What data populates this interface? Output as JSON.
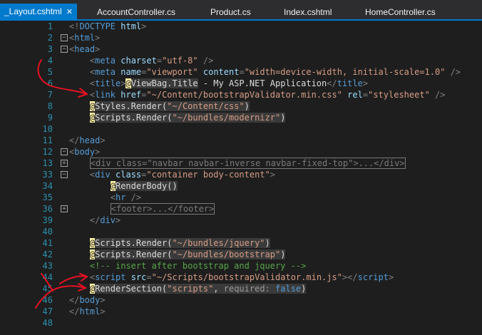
{
  "tabs": [
    {
      "label": "_Layout.cshtml",
      "close": "✕",
      "active": true
    },
    {
      "label": "AccountController.cs"
    },
    {
      "label": "Product.cs"
    },
    {
      "label": "Index.cshtml"
    },
    {
      "label": "HomeController.cs"
    }
  ],
  "lines": [
    {
      "num": "1",
      "fold": "",
      "indent": 0,
      "tokens": [
        {
          "c": "punct",
          "t": "<!"
        },
        {
          "c": "tag",
          "t": "DOCTYPE"
        },
        {
          "c": "txt",
          "t": " "
        },
        {
          "c": "attr",
          "t": "html"
        },
        {
          "c": "punct",
          "t": ">"
        }
      ]
    },
    {
      "num": "2",
      "fold": "−",
      "indent": 0,
      "tokens": [
        {
          "c": "punct",
          "t": "<"
        },
        {
          "c": "tag",
          "t": "html"
        },
        {
          "c": "punct",
          "t": ">"
        }
      ]
    },
    {
      "num": "3",
      "fold": "−",
      "indent": 0,
      "tokens": [
        {
          "c": "punct",
          "t": "<"
        },
        {
          "c": "tag",
          "t": "head"
        },
        {
          "c": "punct",
          "t": ">"
        }
      ]
    },
    {
      "num": "4",
      "fold": "",
      "indent": 4,
      "tokens": [
        {
          "c": "punct",
          "t": "<"
        },
        {
          "c": "tag",
          "t": "meta"
        },
        {
          "c": "txt",
          "t": " "
        },
        {
          "c": "attr",
          "t": "charset"
        },
        {
          "c": "punct",
          "t": "="
        },
        {
          "c": "str",
          "t": "\"utf-8\""
        },
        {
          "c": "txt",
          "t": " "
        },
        {
          "c": "punct",
          "t": "/>"
        }
      ]
    },
    {
      "num": "5",
      "fold": "",
      "indent": 4,
      "tokens": [
        {
          "c": "punct",
          "t": "<"
        },
        {
          "c": "tag",
          "t": "meta"
        },
        {
          "c": "txt",
          "t": " "
        },
        {
          "c": "attr",
          "t": "name"
        },
        {
          "c": "punct",
          "t": "="
        },
        {
          "c": "str",
          "t": "\"viewport\""
        },
        {
          "c": "txt",
          "t": " "
        },
        {
          "c": "attr",
          "t": "content"
        },
        {
          "c": "punct",
          "t": "="
        },
        {
          "c": "str",
          "t": "\"width=device-width, initial-scale=1.0\""
        },
        {
          "c": "txt",
          "t": " "
        },
        {
          "c": "punct",
          "t": "/>"
        }
      ]
    },
    {
      "num": "6",
      "fold": "",
      "indent": 4,
      "tokens": [
        {
          "c": "punct",
          "t": "<"
        },
        {
          "c": "tag",
          "t": "title"
        },
        {
          "c": "punct",
          "t": ">"
        },
        {
          "c": "at",
          "t": "@"
        },
        {
          "c": "razor",
          "t": "ViewBag.Title"
        },
        {
          "c": "txt",
          "t": " - My ASP.NET Application"
        },
        {
          "c": "punct",
          "t": "</"
        },
        {
          "c": "tag",
          "t": "title"
        },
        {
          "c": "punct",
          "t": ">"
        }
      ]
    },
    {
      "num": "7",
      "fold": "",
      "indent": 4,
      "tokens": [
        {
          "c": "punct",
          "t": "<"
        },
        {
          "c": "tag",
          "t": "link"
        },
        {
          "c": "txt",
          "t": " "
        },
        {
          "c": "attr",
          "t": "href"
        },
        {
          "c": "punct",
          "t": "="
        },
        {
          "c": "str",
          "t": "\"~/Content/bootstrapValidator.min.css\""
        },
        {
          "c": "txt",
          "t": " "
        },
        {
          "c": "attr",
          "t": "rel"
        },
        {
          "c": "punct",
          "t": "="
        },
        {
          "c": "str",
          "t": "\"stylesheet\""
        },
        {
          "c": "txt",
          "t": " "
        },
        {
          "c": "punct",
          "t": "/>"
        }
      ]
    },
    {
      "num": "8",
      "fold": "",
      "indent": 4,
      "tokens": [
        {
          "c": "at",
          "t": "@"
        },
        {
          "c": "razor",
          "t": "Styles.Render("
        },
        {
          "c": "str razor",
          "t": "\"~/Content/css\""
        },
        {
          "c": "razor",
          "t": ")"
        }
      ]
    },
    {
      "num": "9",
      "fold": "",
      "indent": 4,
      "tokens": [
        {
          "c": "at",
          "t": "@"
        },
        {
          "c": "razor",
          "t": "Scripts.Render("
        },
        {
          "c": "str razor",
          "t": "\"~/bundles/modernizr\""
        },
        {
          "c": "razor",
          "t": ")"
        }
      ]
    },
    {
      "num": "10",
      "fold": "",
      "indent": 0,
      "tokens": []
    },
    {
      "num": "11",
      "fold": "",
      "indent": 0,
      "tokens": [
        {
          "c": "punct",
          "t": "</"
        },
        {
          "c": "tag",
          "t": "head"
        },
        {
          "c": "punct",
          "t": ">"
        }
      ]
    },
    {
      "num": "12",
      "fold": "−",
      "indent": 0,
      "tokens": [
        {
          "c": "punct",
          "t": "<"
        },
        {
          "c": "tag",
          "t": "body"
        },
        {
          "c": "punct",
          "t": ">"
        }
      ]
    },
    {
      "num": "13",
      "fold": "+",
      "indent": 4,
      "tokens": [
        {
          "c": "collapsed",
          "t": "<div class=\"navbar navbar-inverse navbar-fixed-top\">...</div>"
        }
      ]
    },
    {
      "num": "33",
      "fold": "−",
      "indent": 4,
      "tokens": [
        {
          "c": "punct",
          "t": "<"
        },
        {
          "c": "tag",
          "t": "div"
        },
        {
          "c": "txt",
          "t": " "
        },
        {
          "c": "attr",
          "t": "class"
        },
        {
          "c": "punct",
          "t": "="
        },
        {
          "c": "str",
          "t": "\"container body-content\""
        },
        {
          "c": "punct",
          "t": ">"
        }
      ]
    },
    {
      "num": "34",
      "fold": "",
      "indent": 8,
      "tokens": [
        {
          "c": "at",
          "t": "@"
        },
        {
          "c": "razor",
          "t": "RenderBody()"
        }
      ]
    },
    {
      "num": "35",
      "fold": "",
      "indent": 8,
      "tokens": [
        {
          "c": "punct",
          "t": "<"
        },
        {
          "c": "tag",
          "t": "hr"
        },
        {
          "c": "txt",
          "t": " "
        },
        {
          "c": "punct",
          "t": "/>"
        }
      ]
    },
    {
      "num": "36",
      "fold": "+",
      "indent": 8,
      "tokens": [
        {
          "c": "collapsed",
          "t": "<footer>...</footer>"
        }
      ]
    },
    {
      "num": "39",
      "fold": "",
      "indent": 4,
      "tokens": [
        {
          "c": "punct",
          "t": "</"
        },
        {
          "c": "tag",
          "t": "div"
        },
        {
          "c": "punct",
          "t": ">"
        }
      ]
    },
    {
      "num": "40",
      "fold": "",
      "indent": 0,
      "tokens": []
    },
    {
      "num": "41",
      "fold": "",
      "indent": 4,
      "tokens": [
        {
          "c": "at",
          "t": "@"
        },
        {
          "c": "razor",
          "t": "Scripts.Render("
        },
        {
          "c": "str razor",
          "t": "\"~/bundles/jquery\""
        },
        {
          "c": "razor",
          "t": ")"
        }
      ]
    },
    {
      "num": "42",
      "fold": "",
      "indent": 4,
      "tokens": [
        {
          "c": "at",
          "t": "@"
        },
        {
          "c": "razor",
          "t": "Scripts.Render("
        },
        {
          "c": "str razor",
          "t": "\"~/bundles/bootstrap\""
        },
        {
          "c": "razor",
          "t": ")"
        }
      ]
    },
    {
      "num": "43",
      "fold": "",
      "indent": 4,
      "tokens": [
        {
          "c": "cmt",
          "t": "<!-- insert after bootstrap and jquery -->"
        }
      ]
    },
    {
      "num": "44",
      "fold": "",
      "indent": 4,
      "tokens": [
        {
          "c": "punct",
          "t": "<"
        },
        {
          "c": "tag",
          "t": "script"
        },
        {
          "c": "txt",
          "t": " "
        },
        {
          "c": "attr",
          "t": "src"
        },
        {
          "c": "punct",
          "t": "="
        },
        {
          "c": "str",
          "t": "\"~/Scripts/bootstrapValidator.min.js\""
        },
        {
          "c": "punct",
          "t": "></"
        },
        {
          "c": "tag",
          "t": "script"
        },
        {
          "c": "punct",
          "t": ">"
        }
      ]
    },
    {
      "num": "45",
      "fold": "",
      "indent": 4,
      "tokens": [
        {
          "c": "at",
          "t": "@"
        },
        {
          "c": "razor",
          "t": "RenderSection("
        },
        {
          "c": "str razor",
          "t": "\"scripts\""
        },
        {
          "c": "razor",
          "t": ", "
        },
        {
          "c": "param razor",
          "t": "required:"
        },
        {
          "c": "razor",
          "t": " "
        },
        {
          "c": "kw razor",
          "t": "false"
        },
        {
          "c": "razor",
          "t": ")"
        }
      ]
    },
    {
      "num": "46",
      "fold": "",
      "indent": 0,
      "tokens": [
        {
          "c": "punct",
          "t": "</"
        },
        {
          "c": "tag",
          "t": "body"
        },
        {
          "c": "punct",
          "t": ">"
        }
      ]
    },
    {
      "num": "47",
      "fold": "",
      "indent": 0,
      "tokens": [
        {
          "c": "punct",
          "t": "</"
        },
        {
          "c": "tag",
          "t": "html"
        },
        {
          "c": "punct",
          "t": ">"
        }
      ]
    },
    {
      "num": "48",
      "fold": "",
      "indent": 0,
      "tokens": []
    }
  ],
  "annotation_color": "#e81123"
}
